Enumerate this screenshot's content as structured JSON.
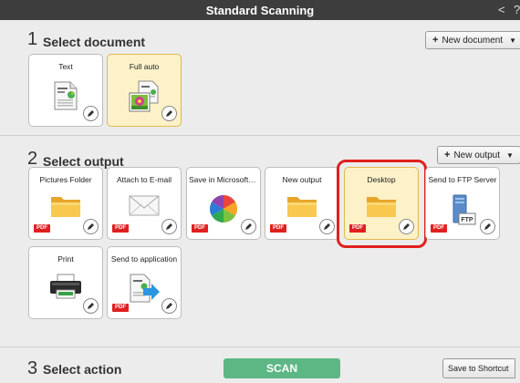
{
  "window": {
    "title": "Standard Scanning",
    "back_glyph": "<",
    "help_glyph": "?"
  },
  "sections": {
    "document": {
      "number": "1",
      "label": "Select document",
      "add_button": "New document"
    },
    "output": {
      "number": "2",
      "label": "Select output",
      "add_button": "New output"
    },
    "action": {
      "number": "3",
      "label": "Select action"
    }
  },
  "document_cards": [
    {
      "label": "Text",
      "icon": "text-document-icon",
      "selected": false
    },
    {
      "label": "Full auto",
      "icon": "image-document-icon",
      "selected": true
    }
  ],
  "output_cards": [
    {
      "label": "Pictures Folder",
      "icon": "folder-icon",
      "badge": "PDF",
      "selected": false
    },
    {
      "label": "Attach to E-mail",
      "icon": "envelope-icon",
      "badge": "PDF",
      "selected": false
    },
    {
      "label": "Save in Microsoft S...",
      "icon": "sharepoint-icon",
      "badge": "PDF",
      "selected": false
    },
    {
      "label": "New output",
      "icon": "folder-icon",
      "badge": "PDF",
      "selected": false
    },
    {
      "label": "Desktop",
      "icon": "folder-icon",
      "badge": "PDF",
      "selected": true
    },
    {
      "label": "Send to FTP Server",
      "icon": "ftp-server-icon",
      "badge": "PDF",
      "selected": false
    },
    {
      "label": "Print",
      "icon": "printer-icon",
      "badge": "",
      "selected": false
    },
    {
      "label": "Send to application",
      "icon": "send-to-application-icon",
      "badge": "PDF",
      "selected": false
    }
  ],
  "actions": {
    "scan_label": "SCAN",
    "shortcut_label": "Save to Shortcut"
  },
  "colors": {
    "title_bar": "#3d3d3d",
    "selected_card": "#fdf1c8",
    "selected_border": "#e0b84c",
    "highlight": "#e0201e",
    "scan_button": "#5cb784",
    "pdf_badge": "#e02020"
  }
}
